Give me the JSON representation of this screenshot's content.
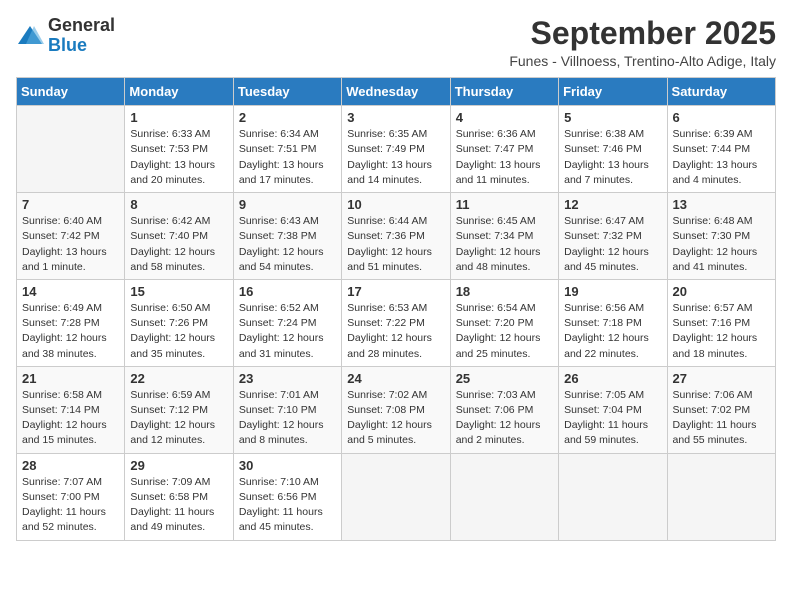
{
  "header": {
    "logo_general": "General",
    "logo_blue": "Blue",
    "month_title": "September 2025",
    "subtitle": "Funes - Villnoess, Trentino-Alto Adige, Italy"
  },
  "days_of_week": [
    "Sunday",
    "Monday",
    "Tuesday",
    "Wednesday",
    "Thursday",
    "Friday",
    "Saturday"
  ],
  "weeks": [
    [
      {
        "day": "",
        "info": ""
      },
      {
        "day": "1",
        "info": "Sunrise: 6:33 AM\nSunset: 7:53 PM\nDaylight: 13 hours\nand 20 minutes."
      },
      {
        "day": "2",
        "info": "Sunrise: 6:34 AM\nSunset: 7:51 PM\nDaylight: 13 hours\nand 17 minutes."
      },
      {
        "day": "3",
        "info": "Sunrise: 6:35 AM\nSunset: 7:49 PM\nDaylight: 13 hours\nand 14 minutes."
      },
      {
        "day": "4",
        "info": "Sunrise: 6:36 AM\nSunset: 7:47 PM\nDaylight: 13 hours\nand 11 minutes."
      },
      {
        "day": "5",
        "info": "Sunrise: 6:38 AM\nSunset: 7:46 PM\nDaylight: 13 hours\nand 7 minutes."
      },
      {
        "day": "6",
        "info": "Sunrise: 6:39 AM\nSunset: 7:44 PM\nDaylight: 13 hours\nand 4 minutes."
      }
    ],
    [
      {
        "day": "7",
        "info": "Sunrise: 6:40 AM\nSunset: 7:42 PM\nDaylight: 13 hours\nand 1 minute."
      },
      {
        "day": "8",
        "info": "Sunrise: 6:42 AM\nSunset: 7:40 PM\nDaylight: 12 hours\nand 58 minutes."
      },
      {
        "day": "9",
        "info": "Sunrise: 6:43 AM\nSunset: 7:38 PM\nDaylight: 12 hours\nand 54 minutes."
      },
      {
        "day": "10",
        "info": "Sunrise: 6:44 AM\nSunset: 7:36 PM\nDaylight: 12 hours\nand 51 minutes."
      },
      {
        "day": "11",
        "info": "Sunrise: 6:45 AM\nSunset: 7:34 PM\nDaylight: 12 hours\nand 48 minutes."
      },
      {
        "day": "12",
        "info": "Sunrise: 6:47 AM\nSunset: 7:32 PM\nDaylight: 12 hours\nand 45 minutes."
      },
      {
        "day": "13",
        "info": "Sunrise: 6:48 AM\nSunset: 7:30 PM\nDaylight: 12 hours\nand 41 minutes."
      }
    ],
    [
      {
        "day": "14",
        "info": "Sunrise: 6:49 AM\nSunset: 7:28 PM\nDaylight: 12 hours\nand 38 minutes."
      },
      {
        "day": "15",
        "info": "Sunrise: 6:50 AM\nSunset: 7:26 PM\nDaylight: 12 hours\nand 35 minutes."
      },
      {
        "day": "16",
        "info": "Sunrise: 6:52 AM\nSunset: 7:24 PM\nDaylight: 12 hours\nand 31 minutes."
      },
      {
        "day": "17",
        "info": "Sunrise: 6:53 AM\nSunset: 7:22 PM\nDaylight: 12 hours\nand 28 minutes."
      },
      {
        "day": "18",
        "info": "Sunrise: 6:54 AM\nSunset: 7:20 PM\nDaylight: 12 hours\nand 25 minutes."
      },
      {
        "day": "19",
        "info": "Sunrise: 6:56 AM\nSunset: 7:18 PM\nDaylight: 12 hours\nand 22 minutes."
      },
      {
        "day": "20",
        "info": "Sunrise: 6:57 AM\nSunset: 7:16 PM\nDaylight: 12 hours\nand 18 minutes."
      }
    ],
    [
      {
        "day": "21",
        "info": "Sunrise: 6:58 AM\nSunset: 7:14 PM\nDaylight: 12 hours\nand 15 minutes."
      },
      {
        "day": "22",
        "info": "Sunrise: 6:59 AM\nSunset: 7:12 PM\nDaylight: 12 hours\nand 12 minutes."
      },
      {
        "day": "23",
        "info": "Sunrise: 7:01 AM\nSunset: 7:10 PM\nDaylight: 12 hours\nand 8 minutes."
      },
      {
        "day": "24",
        "info": "Sunrise: 7:02 AM\nSunset: 7:08 PM\nDaylight: 12 hours\nand 5 minutes."
      },
      {
        "day": "25",
        "info": "Sunrise: 7:03 AM\nSunset: 7:06 PM\nDaylight: 12 hours\nand 2 minutes."
      },
      {
        "day": "26",
        "info": "Sunrise: 7:05 AM\nSunset: 7:04 PM\nDaylight: 11 hours\nand 59 minutes."
      },
      {
        "day": "27",
        "info": "Sunrise: 7:06 AM\nSunset: 7:02 PM\nDaylight: 11 hours\nand 55 minutes."
      }
    ],
    [
      {
        "day": "28",
        "info": "Sunrise: 7:07 AM\nSunset: 7:00 PM\nDaylight: 11 hours\nand 52 minutes."
      },
      {
        "day": "29",
        "info": "Sunrise: 7:09 AM\nSunset: 6:58 PM\nDaylight: 11 hours\nand 49 minutes."
      },
      {
        "day": "30",
        "info": "Sunrise: 7:10 AM\nSunset: 6:56 PM\nDaylight: 11 hours\nand 45 minutes."
      },
      {
        "day": "",
        "info": ""
      },
      {
        "day": "",
        "info": ""
      },
      {
        "day": "",
        "info": ""
      },
      {
        "day": "",
        "info": ""
      }
    ]
  ]
}
